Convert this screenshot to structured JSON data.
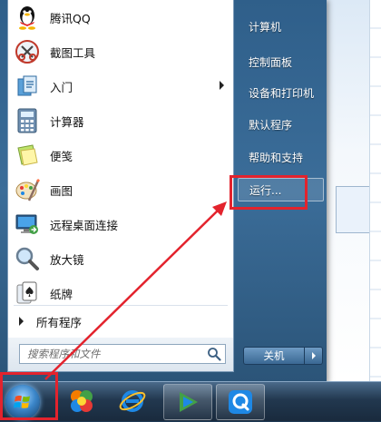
{
  "start_menu": {
    "programs": [
      {
        "label": "腾讯QQ",
        "icon": "qq-penguin-icon"
      },
      {
        "label": "截图工具",
        "icon": "snipping-tool-icon"
      },
      {
        "label": "入门",
        "icon": "getting-started-icon",
        "has_submenu": true
      },
      {
        "label": "计算器",
        "icon": "calculator-icon"
      },
      {
        "label": "便笺",
        "icon": "sticky-notes-icon"
      },
      {
        "label": "画图",
        "icon": "paint-icon"
      },
      {
        "label": "远程桌面连接",
        "icon": "remote-desktop-icon"
      },
      {
        "label": "放大镜",
        "icon": "magnifier-icon"
      },
      {
        "label": "纸牌",
        "icon": "solitaire-icon"
      }
    ],
    "all_programs": "所有程序",
    "search_placeholder": "搜索程序和文件",
    "right_items": [
      "计算机",
      "控制面板",
      "设备和打印机",
      "默认程序",
      "帮助和支持",
      "运行..."
    ],
    "shutdown_label": "关机"
  },
  "taskbar": {
    "buttons": [
      "start-orb",
      "app-colorful-icon",
      "ie-browser-icon",
      "media-player-icon",
      "app-blue-q-icon"
    ]
  },
  "colors": {
    "highlight": "#e3232d"
  }
}
